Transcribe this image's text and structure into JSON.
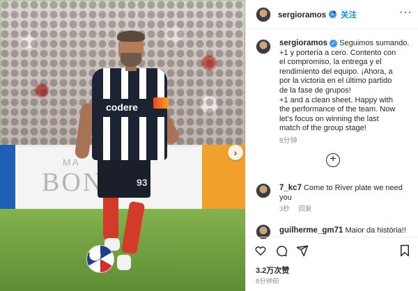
{
  "post": {
    "username": "sergioramos",
    "verified_mark": "✓",
    "follow_label": "关注",
    "separator": "•",
    "more_icon": "···",
    "caption_lines": [
      "Seguimos sumando.",
      "+1 y portería a cero. Contento con",
      "el compromiso, la entrega y el",
      "rendimiento del equipo. ¡Ahora, a",
      "por la victoria en el último partido",
      "de la fase de grupos!",
      "+1 and a clean sheet. Happy with",
      "the performance of the team. Now",
      "let's focus on winning the last",
      "match of the group stage!"
    ],
    "caption_time": "8分钟",
    "load_more_icon": "+",
    "likes": "3.2万次赞",
    "post_time": "8分钟前"
  },
  "media": {
    "sponsor_text": "codere",
    "shirt_number": "93",
    "ad_text": "BONNY",
    "ad_small_text": "MA",
    "next_icon": "›"
  },
  "comments": [
    {
      "username": "7_kc7",
      "text_line1": "Come to River plate we need",
      "text_line2": "you",
      "time": "3秒",
      "reply_label": "回复"
    },
    {
      "username": "guilherme_gm71",
      "text_line1": "Maior da história!!"
    }
  ],
  "icons": {
    "like": "heart-icon",
    "comment": "comment-icon",
    "share": "share-icon",
    "save": "bookmark-icon"
  },
  "colors": {
    "accent": "#0095f6",
    "verified": "#3897f0",
    "muted": "#8e8e8e"
  }
}
